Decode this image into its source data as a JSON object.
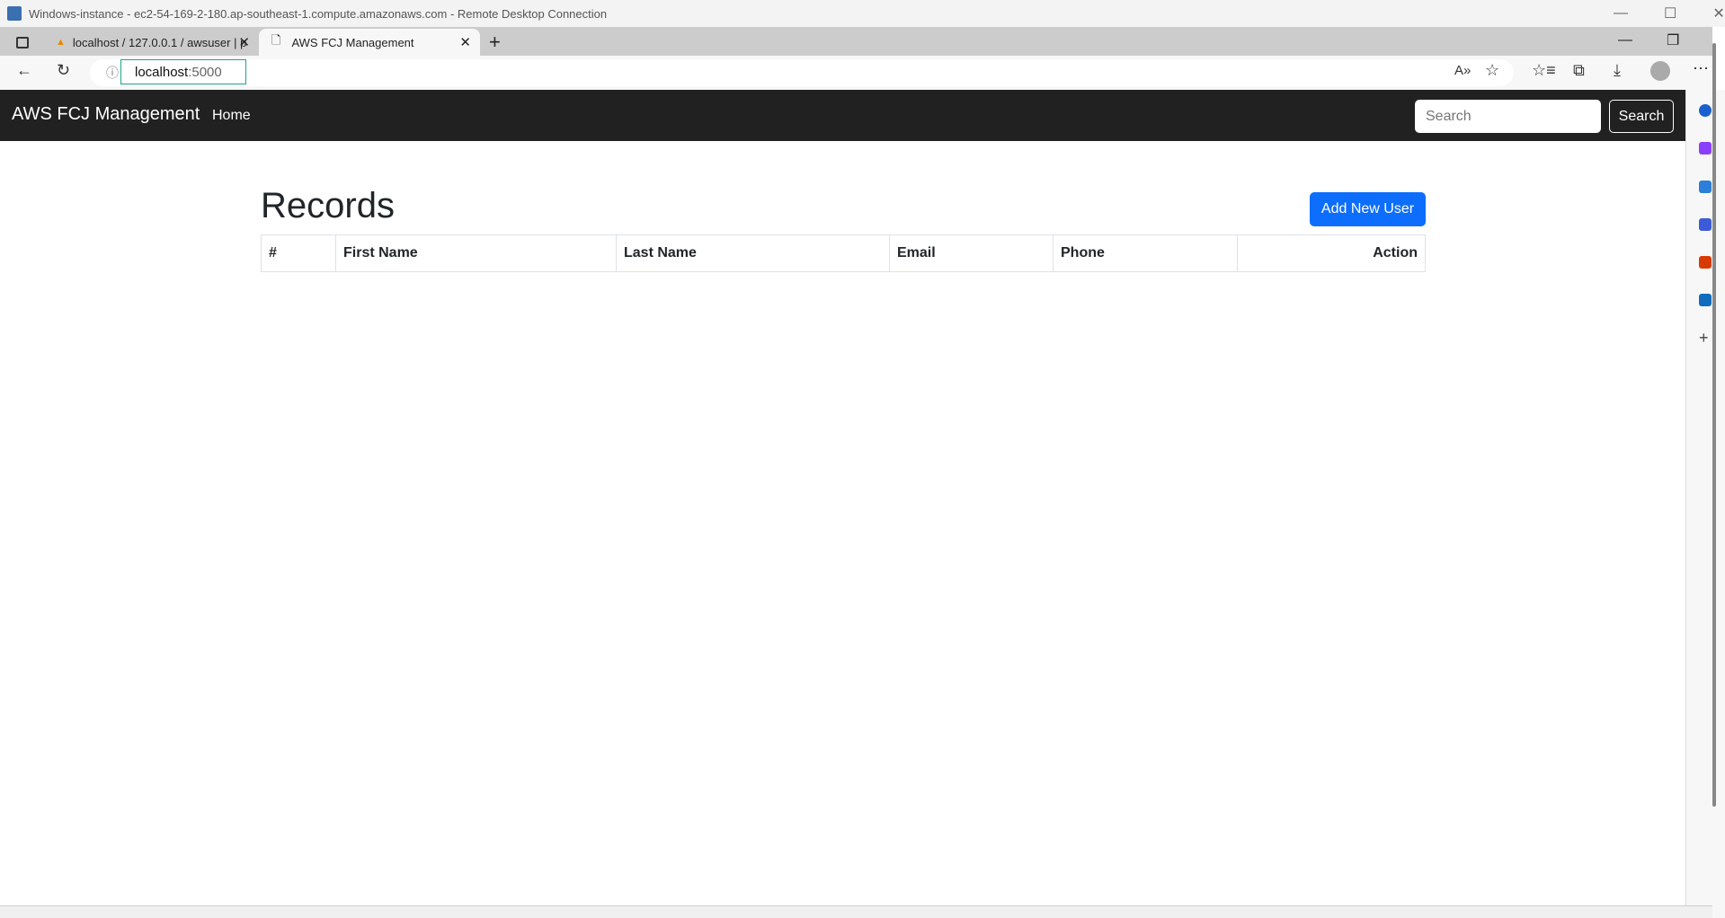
{
  "window": {
    "title": "Windows-instance - ec2-54-169-2-180.ap-southeast-1.compute.amazonaws.com - Remote Desktop Connection"
  },
  "browser": {
    "tabs": [
      {
        "label": "localhost / 127.0.0.1 / awsuser | p",
        "icon": "phpmyadmin-icon"
      },
      {
        "label": "AWS FCJ Management",
        "icon": "page-icon",
        "active": true
      }
    ],
    "address": {
      "host": "localhost",
      "port": ":5000"
    }
  },
  "navbar": {
    "brand": "AWS FCJ Management",
    "links": [
      "Home"
    ],
    "search_placeholder": "Search",
    "search_button": "Search"
  },
  "main": {
    "title": "Records",
    "add_button": "Add New User",
    "table": {
      "headers": [
        "#",
        "First Name",
        "Last Name",
        "Email",
        "Phone",
        "Action"
      ],
      "rows": []
    }
  },
  "colors": {
    "navbar": "#212121",
    "primary": "#0d6efd"
  }
}
